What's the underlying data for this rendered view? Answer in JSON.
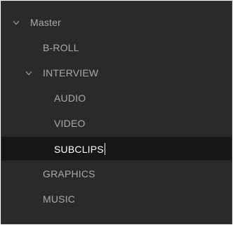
{
  "bin_tree": {
    "master": {
      "label": "Master",
      "expanded": true,
      "icon": "chevron-down-icon"
    },
    "items": [
      {
        "label": "B-ROLL"
      },
      {
        "label": "INTERVIEW",
        "expanded": true,
        "icon": "chevron-down-icon",
        "children": [
          {
            "label": "AUDIO"
          },
          {
            "label": "VIDEO"
          },
          {
            "label": "SUBCLIPS",
            "selected": true,
            "editing": true
          }
        ]
      },
      {
        "label": "GRAPHICS"
      },
      {
        "label": "MUSIC"
      }
    ]
  },
  "colors": {
    "panel_background": "#2a2a2a",
    "selected_background": "#161616",
    "text": "#a9a9a9",
    "selected_text": "#ffffff"
  }
}
